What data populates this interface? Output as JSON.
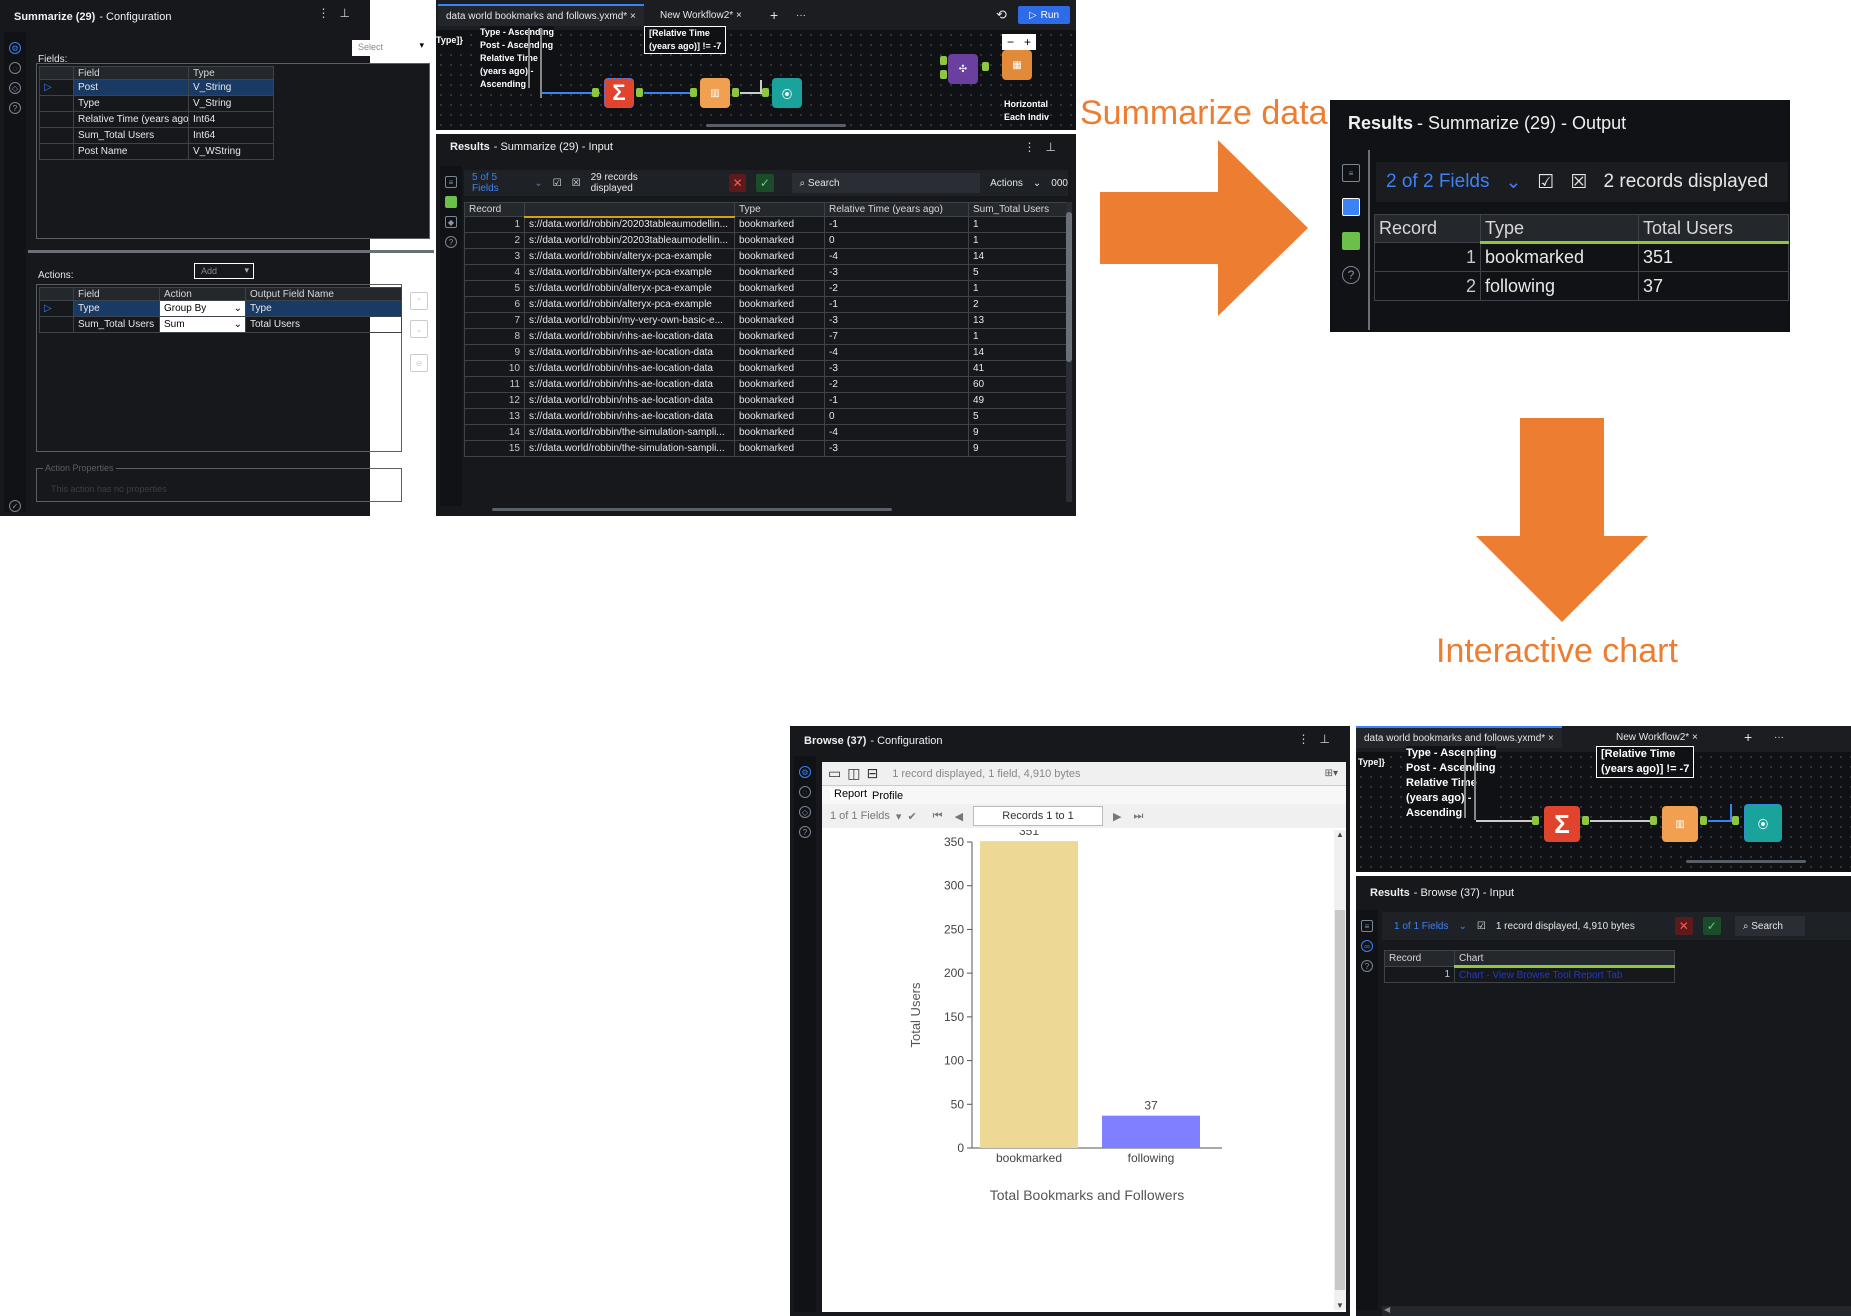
{
  "summarize_config": {
    "title_bold": "Summarize (29)",
    "title_rest": "- Configuration",
    "fields_label": "Fields:",
    "select_label": "Select",
    "fields_headers": [
      "Field",
      "Type"
    ],
    "fields_rows": [
      {
        "field": "Post",
        "type": "V_String"
      },
      {
        "field": "Type",
        "type": "V_String"
      },
      {
        "field": "Relative Time (years ago)",
        "type": "Int64"
      },
      {
        "field": "Sum_Total Users",
        "type": "Int64"
      },
      {
        "field": "Post Name",
        "type": "V_WString"
      }
    ],
    "actions_label": "Actions:",
    "add_label": "Add",
    "actions_headers": [
      "Field",
      "Action",
      "Output Field Name"
    ],
    "actions_rows": [
      {
        "field": "Type",
        "action": "Group By",
        "output": "Type"
      },
      {
        "field": "Sum_Total Users",
        "action": "Sum",
        "output": "Total Users"
      }
    ],
    "action_properties_label": "Action Properties",
    "action_properties_text": "This action has no properties"
  },
  "workflow1": {
    "tab1": "data world bookmarks and follows.yxmd*",
    "tab2": "New Workflow2*",
    "run_label": "Run",
    "ann_left_top": "Type]}",
    "ann_mid": [
      "Type - Ascending",
      "Post - Ascending",
      "Relative Time",
      "(years ago) -",
      "Ascending"
    ],
    "ann_filter": [
      "[Relative Time",
      "(years ago)] != -7"
    ],
    "ann_right": [
      "Horizontal",
      "Each Indiv"
    ],
    "summarize_symbol": "Σ"
  },
  "results_input": {
    "title_bold": "Results",
    "title_rest": "- Summarize (29) - Input",
    "fields_count": "5 of 5 Fields",
    "records_displayed": "29 records displayed",
    "search": "Search",
    "actions": "Actions",
    "digits": "000",
    "headers": [
      "Record",
      "Type",
      "Relative Time (years ago)",
      "Sum_Total Users"
    ],
    "rows": [
      {
        "rec": "1",
        "post": "s://data.world/robbin/20203tableaumodellin...",
        "type": "bookmarked",
        "rel": "-1",
        "sum": "1"
      },
      {
        "rec": "2",
        "post": "s://data.world/robbin/20203tableaumodellin...",
        "type": "bookmarked",
        "rel": "0",
        "sum": "1"
      },
      {
        "rec": "3",
        "post": "s://data.world/robbin/alteryx-pca-example",
        "type": "bookmarked",
        "rel": "-4",
        "sum": "14"
      },
      {
        "rec": "4",
        "post": "s://data.world/robbin/alteryx-pca-example",
        "type": "bookmarked",
        "rel": "-3",
        "sum": "5"
      },
      {
        "rec": "5",
        "post": "s://data.world/robbin/alteryx-pca-example",
        "type": "bookmarked",
        "rel": "-2",
        "sum": "1"
      },
      {
        "rec": "6",
        "post": "s://data.world/robbin/alteryx-pca-example",
        "type": "bookmarked",
        "rel": "-1",
        "sum": "2"
      },
      {
        "rec": "7",
        "post": "s://data.world/robbin/my-very-own-basic-e...",
        "type": "bookmarked",
        "rel": "-3",
        "sum": "13"
      },
      {
        "rec": "8",
        "post": "s://data.world/robbin/nhs-ae-location-data",
        "type": "bookmarked",
        "rel": "-7",
        "sum": "1"
      },
      {
        "rec": "9",
        "post": "s://data.world/robbin/nhs-ae-location-data",
        "type": "bookmarked",
        "rel": "-4",
        "sum": "14"
      },
      {
        "rec": "10",
        "post": "s://data.world/robbin/nhs-ae-location-data",
        "type": "bookmarked",
        "rel": "-3",
        "sum": "41"
      },
      {
        "rec": "11",
        "post": "s://data.world/robbin/nhs-ae-location-data",
        "type": "bookmarked",
        "rel": "-2",
        "sum": "60"
      },
      {
        "rec": "12",
        "post": "s://data.world/robbin/nhs-ae-location-data",
        "type": "bookmarked",
        "rel": "-1",
        "sum": "49"
      },
      {
        "rec": "13",
        "post": "s://data.world/robbin/nhs-ae-location-data",
        "type": "bookmarked",
        "rel": "0",
        "sum": "5"
      },
      {
        "rec": "14",
        "post": "s://data.world/robbin/the-simulation-sampli...",
        "type": "bookmarked",
        "rel": "-4",
        "sum": "9"
      },
      {
        "rec": "15",
        "post": "s://data.world/robbin/the-simulation-sampli...",
        "type": "bookmarked",
        "rel": "-3",
        "sum": "9"
      }
    ]
  },
  "labels": {
    "summarize_data": "Summarize data",
    "interactive_chart": "Interactive chart"
  },
  "results_output": {
    "title_bold": "Results",
    "title_rest": "- Summarize (29) - Output",
    "fields_count": "2 of 2 Fields",
    "records_displayed": "2 records displayed",
    "headers": [
      "Record",
      "Type",
      "Total Users"
    ],
    "rows": [
      {
        "rec": "1",
        "type": "bookmarked",
        "total": "351"
      },
      {
        "rec": "2",
        "type": "following",
        "total": "37"
      }
    ]
  },
  "browse_config": {
    "title_bold": "Browse (37)",
    "title_rest": "- Configuration",
    "info": "1 record displayed, 1 field, 4,910 bytes",
    "tab_report": "Report",
    "tab_profile": "Profile",
    "fields_count": "1 of 1 Fields",
    "records_range": "Records 1 to 1"
  },
  "chart_data": {
    "type": "bar",
    "categories": [
      "bookmarked",
      "following"
    ],
    "values": [
      351,
      37
    ],
    "colors": [
      "#edd995",
      "#7f7fff"
    ],
    "title": "Total Bookmarks and Followers",
    "xlabel": "",
    "ylabel": "Total Users",
    "ylim": [
      0,
      350
    ],
    "yticks": [
      0,
      50,
      100,
      150,
      200,
      250,
      300,
      350
    ],
    "grid": false,
    "legend": "none"
  },
  "workflow2": {
    "tab1": "data world bookmarks and follows.yxmd*",
    "tab2": "New Workflow2*",
    "ann_left_top": "Type]}",
    "ann_mid": [
      "Type - Ascending",
      "Post - Ascending",
      "Relative Time",
      "(years ago) -",
      "Ascending"
    ],
    "ann_filter": [
      "[Relative Time",
      "(years ago)] != -7"
    ],
    "summarize_symbol": "Σ"
  },
  "results_browse": {
    "title_bold": "Results",
    "title_rest": "- Browse (37) - Input",
    "fields_count": "1 of 1 Fields",
    "records_displayed": "1 record displayed, 4,910 bytes",
    "search": "Search",
    "headers": [
      "Record",
      "Chart"
    ],
    "rows": [
      {
        "rec": "1",
        "chart": "Chart - View Browse Tool Report Tab"
      }
    ]
  },
  "colors": {
    "accent_blue": "#3b82f6",
    "orange_arrow": "#ed7d31",
    "panel_dark": "#16181c",
    "anchor_green": "#8dc63f"
  }
}
